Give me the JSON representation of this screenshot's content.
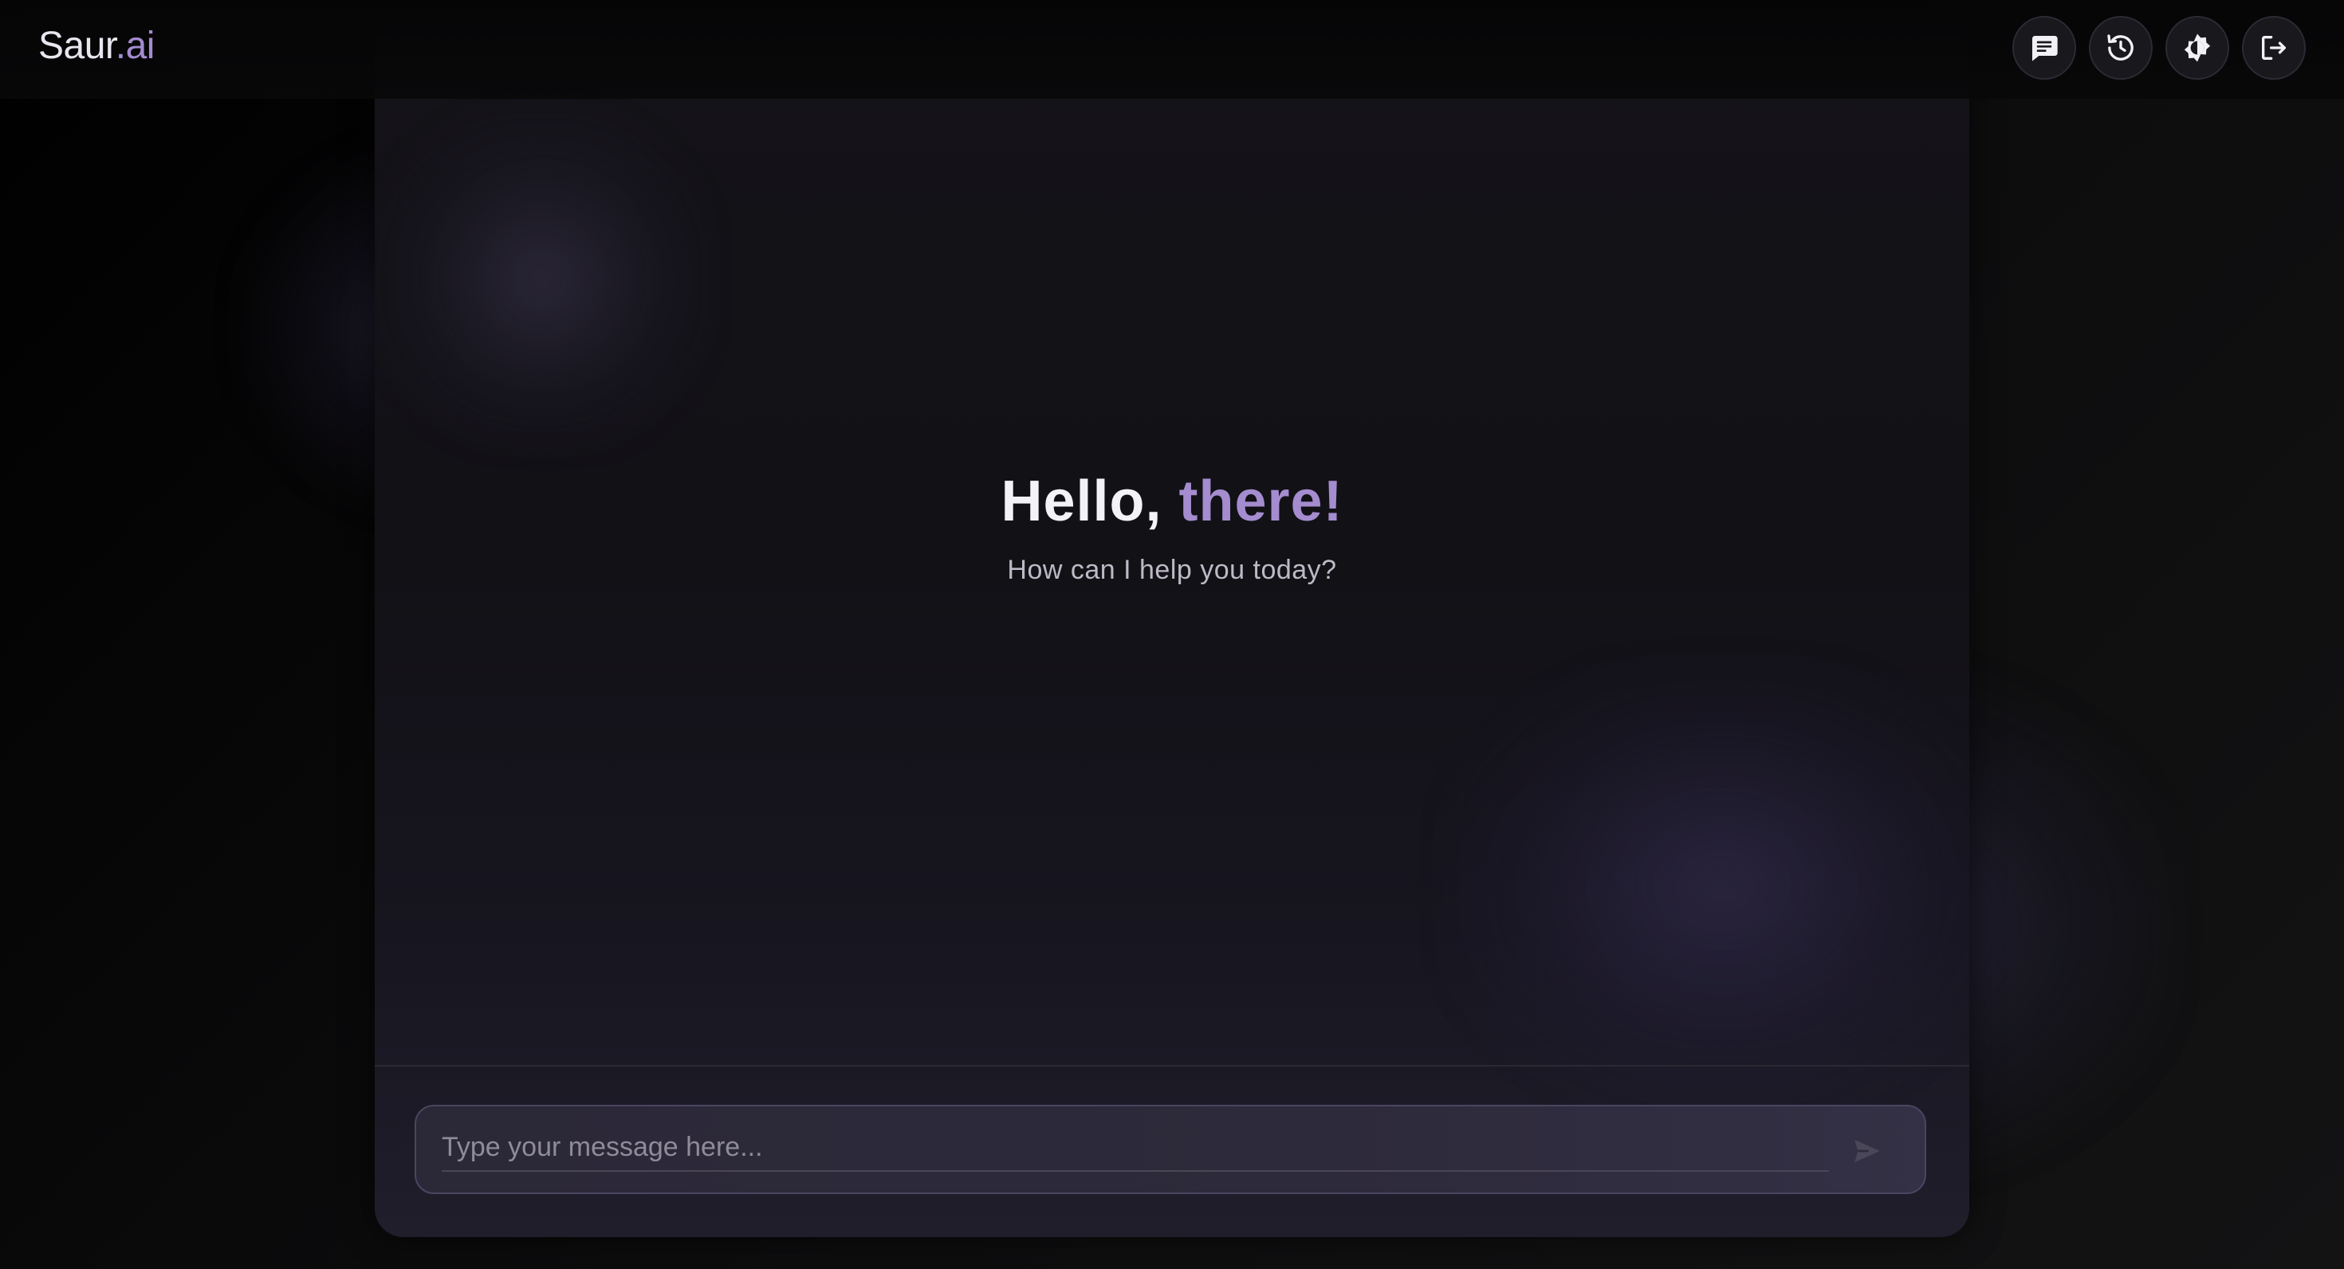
{
  "header": {
    "logo_main": "Saur",
    "logo_accent": ".ai",
    "icons": [
      {
        "name": "chat-icon"
      },
      {
        "name": "history-icon"
      },
      {
        "name": "theme-toggle-icon"
      },
      {
        "name": "logout-icon"
      }
    ]
  },
  "welcome": {
    "greeting": "Hello,",
    "name": "there!",
    "subtitle": "How can I help you today?"
  },
  "composer": {
    "placeholder": "Type your message here...",
    "value": ""
  },
  "colors": {
    "accent": "#a48ccf",
    "background": "#0b0b0c",
    "card": "#141318"
  }
}
